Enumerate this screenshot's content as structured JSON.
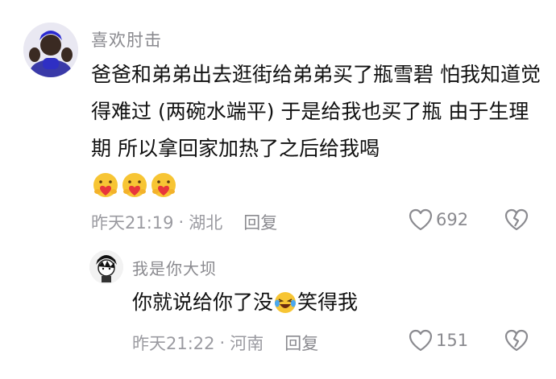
{
  "comment": {
    "username": "喜欢肘击",
    "text": "爸爸和弟弟出去逛街给弟弟买了瓶雪碧 怕我知道觉得难过 (两碗水端平) 于是给我也买了瓶 由于生理期 所以拿回家加热了之后给我喝",
    "emoji_icons": [
      "heart-hug-emoji",
      "heart-hug-emoji",
      "heart-hug-emoji"
    ],
    "time": "昨天21:19",
    "separator": "·",
    "location": "湖北",
    "reply_label": "回复",
    "likes": "692"
  },
  "reply": {
    "username": "我是你大坝",
    "text_before": "你就说给你了没",
    "emoji": "laughing-tears-emoji",
    "text_after": "笑得我",
    "time": "昨天21:22",
    "separator": "·",
    "location": "河南",
    "reply_label": "回复",
    "likes": "151"
  },
  "colors": {
    "meta": "#9a9aa0",
    "text": "#111111",
    "emoji_yellow": "#f7c534",
    "heart_red": "#e8353b"
  }
}
